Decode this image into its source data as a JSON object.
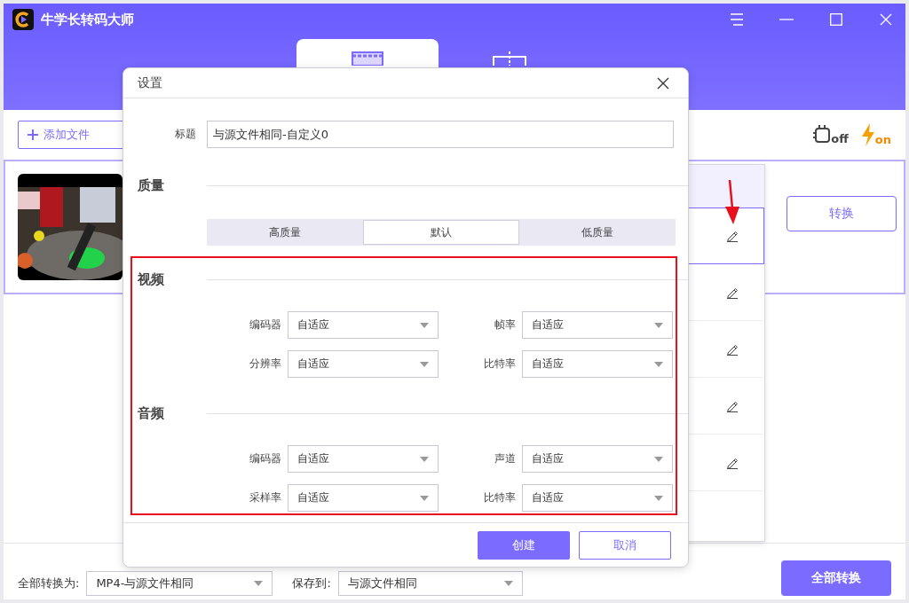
{
  "window": {
    "title": "牛学长转码大师"
  },
  "mode_tabs": [
    {
      "selected": true
    },
    {
      "selected": false
    }
  ],
  "toolbar": {
    "add_button": "添加文件",
    "gpu_label": "off",
    "speed_label": "on"
  },
  "file": {
    "convert_button": "转换"
  },
  "preset_list": {
    "rows": [
      {
        "selected": true
      },
      {
        "selected": false
      },
      {
        "selected": false
      },
      {
        "selected": false
      },
      {
        "selected": false
      }
    ]
  },
  "bottom_bar": {
    "format_label": "全部转换为:",
    "format_value": "MP4-与源文件相同",
    "save_label": "保存到:",
    "save_value": "与源文件相同",
    "convert_all_button": "全部转换"
  },
  "dialog": {
    "title": "设置",
    "name_label": "标题",
    "name_value": "与源文件相同-自定义0",
    "quality": {
      "heading": "质量",
      "options": [
        {
          "label": "高质量",
          "selected": false
        },
        {
          "label": "默认",
          "selected": true
        },
        {
          "label": "低质量",
          "selected": false
        }
      ]
    },
    "sections": [
      {
        "heading": "视频",
        "fields": [
          {
            "label": "编码器",
            "value": "自适应"
          },
          {
            "label": "帧率",
            "value": "自适应"
          },
          {
            "label": "分辨率",
            "value": "自适应"
          },
          {
            "label": "比特率",
            "value": "自适应"
          }
        ]
      },
      {
        "heading": "音频",
        "fields": [
          {
            "label": "编码器",
            "value": "自适应"
          },
          {
            "label": "声道",
            "value": "自适应"
          },
          {
            "label": "采样率",
            "value": "自适应"
          },
          {
            "label": "比特率",
            "value": "自适应"
          }
        ]
      }
    ],
    "buttons": [
      {
        "label": "创建",
        "kind": "primary"
      },
      {
        "label": "取消",
        "kind": "secondary"
      }
    ]
  }
}
